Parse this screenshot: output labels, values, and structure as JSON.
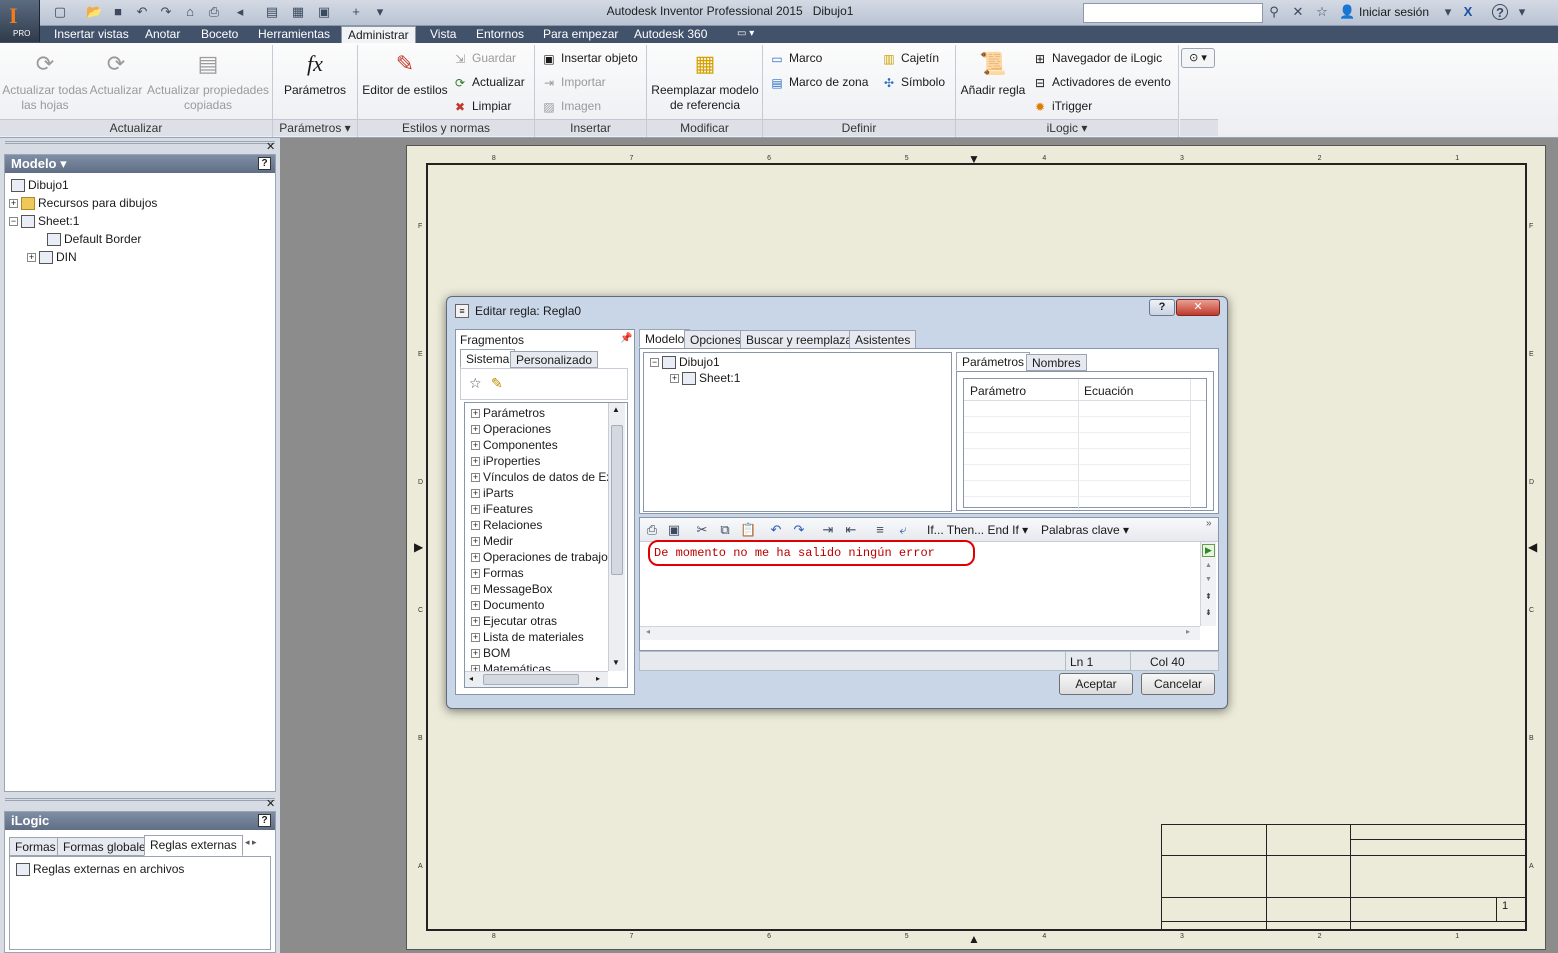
{
  "app": {
    "title": "Autodesk Inventor Professional 2015",
    "document": "Dibujo1",
    "edition": "PRO",
    "login": "Iniciar sesión"
  },
  "menu": {
    "items": [
      "Insertar vistas",
      "Anotar",
      "Boceto",
      "Herramientas",
      "Administrar",
      "Vista",
      "Entornos",
      "Para empezar",
      "Autodesk 360"
    ],
    "active": "Administrar"
  },
  "ribbon": {
    "actualizar": {
      "label": "Actualizar",
      "btn1": "Actualizar todas las hojas",
      "btn2": "Actualizar",
      "btn3": "Actualizar propiedades copiadas"
    },
    "parametros": {
      "label": "Parámetros",
      "btn": "Parámetros"
    },
    "estilos": {
      "label": "Estilos y normas",
      "editor": "Editor de estilos",
      "guardar": "Guardar",
      "actualizar": "Actualizar",
      "limpiar": "Limpiar"
    },
    "insertar": {
      "label": "Insertar",
      "objeto": "Insertar objeto",
      "importar": "Importar",
      "imagen": "Imagen"
    },
    "modificar": {
      "label": "Modificar",
      "btn": "Reemplazar modelo de referencia"
    },
    "definir": {
      "label": "Definir",
      "marco": "Marco",
      "marco_zona": "Marco de zona",
      "cajetin": "Cajetín",
      "simbolo": "Símbolo"
    },
    "ilogic": {
      "label": "iLogic",
      "anadir": "Añadir regla",
      "navegador": "Navegador de iLogic",
      "activadores": "Activadores de evento",
      "itrigger": "iTrigger"
    }
  },
  "model_browser": {
    "title": "Modelo",
    "items": [
      "Dibujo1",
      "Recursos para dibujos",
      "Sheet:1",
      "Default Border",
      "DIN"
    ]
  },
  "ilogic_browser": {
    "title": "iLogic",
    "tabs": [
      "Formas",
      "Formas globales",
      "Reglas externas"
    ],
    "active_tab": "Reglas externas",
    "item": "Reglas externas en archivos"
  },
  "drawing": {
    "col_numbers": [
      "8",
      "7",
      "6",
      "5",
      "4",
      "3",
      "2",
      "1"
    ],
    "row_letters": [
      "F",
      "E",
      "D",
      "C",
      "B",
      "A"
    ],
    "sheet_number": "1"
  },
  "dialog": {
    "title": "Editar regla: Regla0",
    "fragmentos": "Fragmentos",
    "frag_tabs": [
      "Sistema",
      "Personalizado"
    ],
    "frag_items": [
      "Parámetros",
      "Operaciones",
      "Componentes",
      "iProperties",
      "Vínculos de datos de Exc",
      "iParts",
      "iFeatures",
      "Relaciones",
      "Medir",
      "Operaciones de trabajo",
      "Formas",
      "MessageBox",
      "Documento",
      "Ejecutar otras",
      "Lista de materiales",
      "BOM",
      "Matemáticas"
    ],
    "main_tabs": [
      "Modelo",
      "Opciones",
      "Buscar y reemplazar",
      "Asistentes"
    ],
    "model_tree": [
      "Dibujo1",
      "Sheet:1"
    ],
    "param_tabs": [
      "Parámetros",
      "Nombres"
    ],
    "param_cols": [
      "Parámetro",
      "Ecuación"
    ],
    "toolbar_if": "If... Then... End If",
    "toolbar_keywords": "Palabras clave",
    "code": "De momento no me ha salido ningún error",
    "status_ln": "Ln 1",
    "status_col": "Col 40",
    "ok": "Aceptar",
    "cancel": "Cancelar"
  }
}
